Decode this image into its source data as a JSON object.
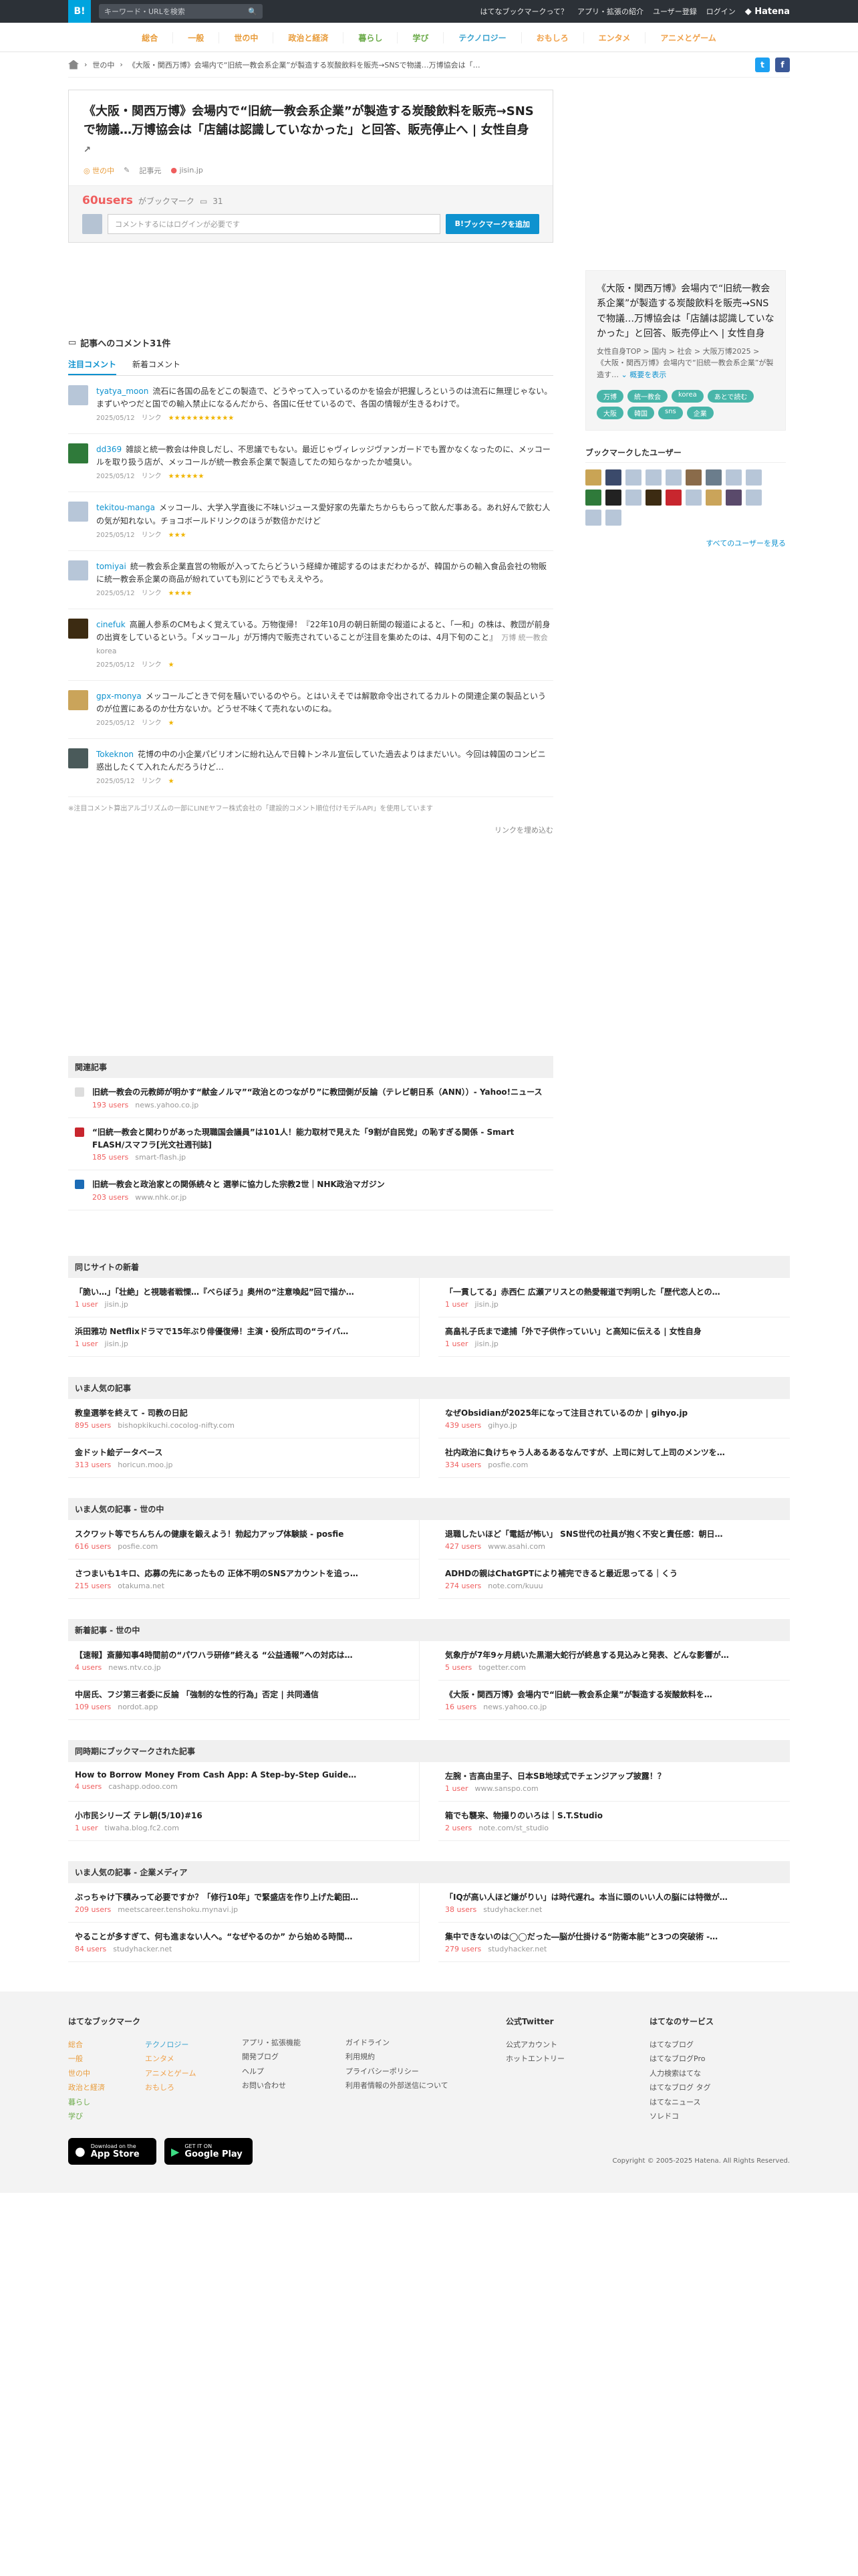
{
  "topbar": {
    "logo": "B!",
    "search_placeholder": "キーワード・URLを検索",
    "links": [
      "はてなブックマークって？",
      "アプリ・拡張の紹介",
      "ユーザー登録",
      "ログイン"
    ],
    "brand": "Hatena"
  },
  "catnav": [
    {
      "label": "総合",
      "color": "#e89b39"
    },
    {
      "label": "一般",
      "color": "#e89b39"
    },
    {
      "label": "世の中",
      "color": "#e89b39"
    },
    {
      "label": "政治と経済",
      "color": "#e89b39"
    },
    {
      "label": "暮らし",
      "color": "#6cab4a"
    },
    {
      "label": "学び",
      "color": "#6cab4a"
    },
    {
      "label": "テクノロジー",
      "color": "#3aa3cf"
    },
    {
      "label": "おもしろ",
      "color": "#f0a14a"
    },
    {
      "label": "エンタメ",
      "color": "#f0a14a"
    },
    {
      "label": "アニメとゲーム",
      "color": "#f0a14a"
    }
  ],
  "breadcrumb": {
    "category": "世の中",
    "title": "《大阪・関西万博》会場内で“旧統一教会系企業”が製造する炭酸飲料を販売→SNSで物議…万博協会は「…"
  },
  "entry": {
    "title": "《大阪・関西万博》会場内で“旧統一教会系企業”が製造する炭酸飲料を販売→SNSで物議…万博協会は「店舗は認識していなかった」と回答、販売停止へ | 女性自身",
    "category": "世の中",
    "record_label": "記事元",
    "domain": "jisin.jp",
    "users": "60users",
    "bookmark_text": "がブックマーク",
    "comment_count": "31",
    "comment_placeholder": "コメントするにはログインが必要です",
    "add_button": "ブックマークを追加"
  },
  "comments": {
    "heading": "記事へのコメント31件",
    "tabs": [
      "注目コメント",
      "新着コメント"
    ],
    "items": [
      {
        "user": "tyatya_moon",
        "text": "流石に各国の品をどこの製造で、どうやって入っているのかを協会が把握しろというのは流石に無理じゃない。まずいやつだと国での輸入禁止になるんだから、各国に任せているので、各国の情報が生きるわけで。",
        "date": "2025/05/12",
        "link": "リンク",
        "stars": "★★★★★★★★★★★",
        "color": "#b7c6d8"
      },
      {
        "user": "dd369",
        "text": "雑談と統一教会は仲良しだし、不思議でもない。最近じゃヴィレッジヴァンガードでも置かなくなったのに、メッコールを取り扱う店が、メッコールが統一教会系企業で製造してたの知らなかったか嘘臭い。",
        "date": "2025/05/12",
        "link": "リンク",
        "stars": "★★★★★★",
        "color": "#2f7a3a"
      },
      {
        "user": "tekitou-manga",
        "text": "メッコール、大学入学直後に不味いジュース愛好家の先輩たちからもらって飲んだ事ある。あれ好んで飲む人の気が知れない。チョコボールドリンクのほうが数倍かだけど",
        "date": "2025/05/12",
        "link": "リンク",
        "stars": "★★★",
        "color": "#b7c6d8"
      },
      {
        "user": "tomiyai",
        "text": "統一教会系企業直営の物販が入ってたらどういう経緯か確認するのはまだわかるが、韓国からの輸入食品会社の物販に統一教会系企業の商品が紛れていても別にどうでもええやろ。",
        "date": "2025/05/12",
        "link": "リンク",
        "stars": "★★★★",
        "color": "#b7c6d8"
      },
      {
        "user": "cinefuk",
        "text": "高麗人参系のCMもよく覚えている。万物復帰！『22年10月の朝日新聞の報道によると、「一和」の株は、教団が前身の出資をしているという。「メッコール」が万博内で販売されていることが注目を集めたのは、4月下旬のこと』",
        "tags": "万博 統一教会 korea",
        "date": "2025/05/12",
        "link": "リンク",
        "stars": "★",
        "color": "#3c2b12"
      },
      {
        "user": "gpx-monya",
        "text": "メッコールごときで何を騒いでいるのやら。とはいえそでは解散命令出されてるカルトの関連企業の製品というのが位置にあるのか仕方ないか。どうせ不味くて売れないのにね。",
        "date": "2025/05/12",
        "link": "リンク",
        "stars": "★",
        "color": "#caa45a"
      },
      {
        "user": "Tokeknon",
        "text": "花博の中の小企業パビリオンに紛れ込んで日韓トンネル宣伝していた過去よりはまだいい。今回は韓国のコンビニ惑出したくて入れたんだろうけど…",
        "date": "2025/05/12",
        "link": "リンク",
        "stars": "★",
        "color": "#4a5a5a"
      }
    ],
    "note": "※注目コメント算出アルゴリズムの一部にLINEヤフー株式会社の「建設的コメント順位付けモデルAPI」を使用しています",
    "more": "リンクを埋め込む"
  },
  "related": {
    "heading": "関連記事",
    "items": [
      {
        "title": "旧統一教会の元教師が明かす“献金ノルマ”“政治とのつながり”に教団側が反論（テレビ朝日系（ANN））- Yahoo!ニュース",
        "users": "193 users",
        "domain": "news.yahoo.co.jp",
        "fav_color": "#dddddd"
      },
      {
        "title": "“旧統一教会と関わりがあった現職国会議員”は101人！能力取材で見えた「9割が自民党」の恥すぎる関係 - Smart FLASH/スマフラ[光文社週刊誌]",
        "users": "185 users",
        "domain": "smart-flash.jp",
        "fav_color": "#c8262e"
      },
      {
        "title": "旧統一教会と政治家との関係続々と 選挙に協力した宗教2世｜NHK政治マガジン",
        "users": "203 users",
        "domain": "www.nhk.or.jp",
        "fav_color": "#1b6bb5"
      }
    ]
  },
  "sidebar": {
    "title": "《大阪・関西万博》会場内で“旧統一教会系企業”が製造する炭酸飲料を販売→SNSで物議…万博協会は「店舗は認識していなかった」と回答、販売停止へ | 女性自身",
    "path": "女性自身TOP > 国内 > 社会 > 大阪万博2025 > 《大阪・関西万博》会場内で“旧統一教会系企業”が製造す…",
    "summary_link": "概要を表示",
    "tags": [
      "万博",
      "統一教会",
      "korea",
      "あとで読む",
      "大阪",
      "韓国",
      "sns",
      "企業"
    ],
    "bookmark_users_heading": "ブックマークしたユーザー",
    "all_users": "すべてのユーザーを見る",
    "user_colors": [
      "#c9a455",
      "#3b4a6b",
      "#b7c6d8",
      "#b7c6d8",
      "#b7c6d8",
      "#8a6b4a",
      "#6b7d8c",
      "#b7c6d8",
      "#b7c6d8",
      "#2f7a3a",
      "#222222",
      "#b7c6d8",
      "#3c2b12",
      "#c8262e",
      "#b7c6d8",
      "#caa45a",
      "#5a4a6b",
      "#b7c6d8",
      "#b7c6d8",
      "#b7c6d8"
    ]
  },
  "feeds": [
    {
      "heading": "同じサイトの新着",
      "items": [
        {
          "title": "「脆い…」「壮絶」と視聴者戦慄…『べらぼう』奥州の“注意喚起”回で描か…",
          "users": "1 user",
          "domain": "jisin.jp"
        },
        {
          "title": "「一貫してる」赤西仁 広瀬アリスとの熱愛報道で判明した「歴代恋人との…",
          "users": "1 user",
          "domain": "jisin.jp"
        },
        {
          "title": "浜田雅功 Netflixドラマで15年ぶり俳優復帰！主演・役所広司の“ライバ…",
          "users": "1 user",
          "domain": "jisin.jp"
        },
        {
          "title": "高畠礼子氏まで逮捕「外で子供作っていい」と高知に伝える | 女性自身",
          "users": "1 user",
          "domain": "jisin.jp"
        }
      ]
    },
    {
      "heading": "いま人気の記事",
      "items": [
        {
          "title": "教皇選挙を終えて - 司教の日記",
          "users": "895 users",
          "domain": "bishopkikuchi.cocolog-nifty.com"
        },
        {
          "title": "なぜObsidianが2025年になって注目されているのか | gihyo.jp",
          "users": "439 users",
          "domain": "gihyo.jp"
        },
        {
          "title": "金ドット絵データベース",
          "users": "313 users",
          "domain": "horicun.moo.jp"
        },
        {
          "title": "社内政治に負けちゃう人あるあるなんですが、上司に対して上司のメンツを…",
          "users": "334 users",
          "domain": "posfie.com"
        }
      ]
    },
    {
      "heading": "いま人気の記事 - 世の中",
      "items": [
        {
          "title": "スクワット等でちんちんの健康を鍛えよう！勃起力アップ体験談 - posfie",
          "users": "616 users",
          "domain": "posfie.com"
        },
        {
          "title": "退職したいほど「電話が怖い」 SNS世代の社員が抱く不安と責任感：朝日…",
          "users": "427 users",
          "domain": "www.asahi.com"
        },
        {
          "title": "さつまいも1キロ、応募の先にあったもの 正体不明のSNSアカウントを追っ…",
          "users": "215 users",
          "domain": "otakuma.net"
        },
        {
          "title": "ADHDの親はChatGPTにより補完できると最近思ってる｜くう",
          "users": "274 users",
          "domain": "note.com/kuuu"
        }
      ]
    },
    {
      "heading": "新着記事 - 世の中",
      "items": [
        {
          "title": "【速報】斎藤知事4時間前の“パワハラ研修”終える “公益通報”への対応は…",
          "users": "4 users",
          "domain": "news.ntv.co.jp"
        },
        {
          "title": "気象庁が7年9ヶ月続いた黒潮大蛇行が終息する見込みと発表、どんな影響が…",
          "users": "5 users",
          "domain": "togetter.com"
        },
        {
          "title": "中居氏、フジ第三者委に反論 「強制的な性的行為」否定 | 共同通信",
          "users": "109 users",
          "domain": "nordot.app"
        },
        {
          "title": "《大阪・関西万博》会場内で“旧統一教会系企業”が製造する炭酸飲料を…",
          "users": "16 users",
          "domain": "news.yahoo.co.jp"
        }
      ]
    },
    {
      "heading": "同時期にブックマークされた記事",
      "items": [
        {
          "title": "How to Borrow Money From Cash App: A Step-by-Step Guide…",
          "users": "4 users",
          "domain": "cashapp.odoo.com"
        },
        {
          "title": "左腕・吉高由里子、日本SB地球式でチェンジアップ披露！？",
          "users": "1 user",
          "domain": "www.sanspo.com"
        },
        {
          "title": "小市民シリーズ テレ朝(5/10)#16",
          "users": "1 user",
          "domain": "tiwaha.blog.fc2.com"
        },
        {
          "title": "箱でも襲来、物撮りのいろは｜S.T.Studio",
          "users": "2 users",
          "domain": "note.com/st_studio"
        }
      ]
    },
    {
      "heading": "いま人気の記事 - 企業メディア",
      "items": [
        {
          "title": "ぶっちゃけ下積みって必要ですか？「修行10年」で緊盛店を作り上げた範田…",
          "users": "209 users",
          "domain": "meetscareer.tenshoku.mynavi.jp"
        },
        {
          "title": "「IQが高い人ほど嫌がりい」は時代遅れ。本当に頭のいい人の脳には特徴が…",
          "users": "38 users",
          "domain": "studyhacker.net"
        },
        {
          "title": "やることが多すぎて、何も進まない人へ。“なぜやるのか” から始める時間…",
          "users": "84 users",
          "domain": "studyhacker.net"
        },
        {
          "title": "集中できないのは◯◯だった―脳が仕掛ける“防衛本能”と3つの突破術 -…",
          "users": "279 users",
          "domain": "studyhacker.net"
        }
      ]
    }
  ],
  "footer": {
    "hb_heading": "はてなブックマーク",
    "cats_left": [
      {
        "label": "総合",
        "color": "#e89b39"
      },
      {
        "label": "テクノロジー",
        "color": "#3aa3cf"
      },
      {
        "label": "一般",
        "color": "#e89b39"
      },
      {
        "label": "エンタメ",
        "color": "#f0a14a"
      },
      {
        "label": "世の中",
        "color": "#e89b39"
      },
      {
        "label": "アニメとゲーム",
        "color": "#f0a14a"
      },
      {
        "label": "政治と経済",
        "color": "#e89b39"
      },
      {
        "label": "おもしろ",
        "color": "#f0a14a"
      },
      {
        "label": "暮らし",
        "color": "#6cab4a"
      },
      {
        "label": "",
        "color": "#555"
      },
      {
        "label": "学び",
        "color": "#6cab4a"
      },
      {
        "label": "",
        "color": "#555"
      }
    ],
    "col2": [
      "アプリ・拡張機能",
      "開発ブログ",
      "ヘルプ",
      "お問い合わせ"
    ],
    "col3": [
      "ガイドライン",
      "利用規約",
      "プライバシーポリシー",
      "利用者情報の外部送信について"
    ],
    "twitter_heading": "公式Twitter",
    "twitter": [
      "公式アカウント",
      "ホットエントリー"
    ],
    "service_heading": "はてなのサービス",
    "services": [
      "はてなブログ",
      "はてなブログPro",
      "人力検索はてな",
      "はてなブログ タグ",
      "はてなニュース",
      "ソレドコ"
    ],
    "appstore": {
      "small": "Download on the",
      "big": "App Store"
    },
    "googleplay": {
      "small": "GET IT ON",
      "big": "Google Play"
    },
    "copyright": "Copyright © 2005-2025 Hatena. All Rights Reserved."
  }
}
